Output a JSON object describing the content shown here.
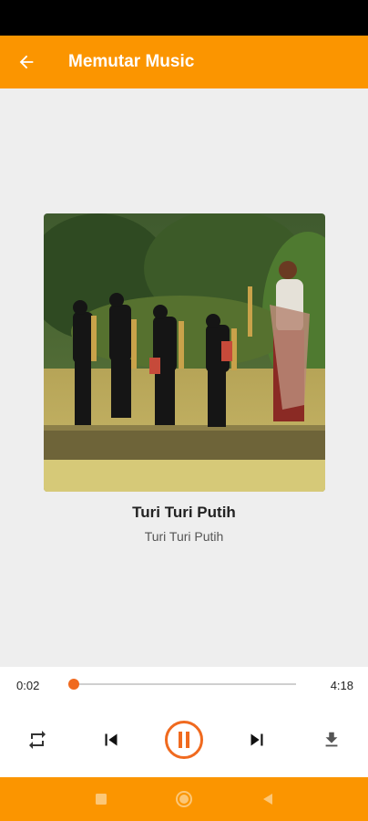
{
  "app_bar": {
    "title": "Memutar Music",
    "back_icon": "arrow-left-icon",
    "color": "#fb9500"
  },
  "song": {
    "title": "Turi Turi Putih",
    "artist": "Turi Turi Putih",
    "album_art": "photo of children in black traditional clothing holding angklung bamboo instruments in a field"
  },
  "player": {
    "current_time": "0:02",
    "duration": "4:18",
    "progress": 0.008,
    "accent": "#f06a1f",
    "controls": [
      "repeat-icon",
      "skip-previous-icon",
      "pause-icon",
      "skip-next-icon",
      "download-icon"
    ]
  },
  "system_nav": {
    "icons": [
      "recents-square-icon",
      "home-circle-icon",
      "back-triangle-icon"
    ]
  }
}
